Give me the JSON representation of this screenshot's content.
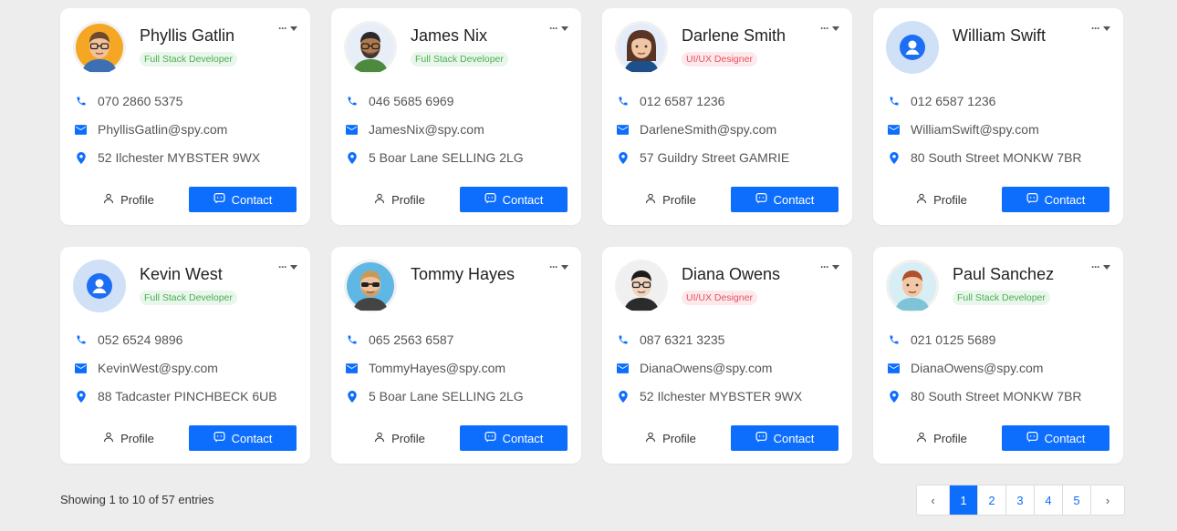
{
  "cards": [
    {
      "name": "Phyllis Gatlin",
      "role": "Full Stack Developer",
      "role_type": "fs",
      "phone": "070 2860 5375",
      "email": "PhyllisGatlin@spy.com",
      "address": "52 Ilchester MYBSTER 9WX",
      "avatar": "avatar-man-glasses",
      "profile_label": "Profile",
      "contact_label": "Contact"
    },
    {
      "name": "James Nix",
      "role": "Full Stack Developer",
      "role_type": "fs",
      "phone": "046 5685 6969",
      "email": "JamesNix@spy.com",
      "address": "5 Boar Lane SELLING 2LG",
      "avatar": "avatar-man-beard",
      "profile_label": "Profile",
      "contact_label": "Contact"
    },
    {
      "name": "Darlene Smith",
      "role": "UI/UX Designer",
      "role_type": "ux",
      "phone": "012 6587 1236",
      "email": "DarleneSmith@spy.com",
      "address": "57 Guildry Street GAMRIE",
      "avatar": "avatar-woman",
      "profile_label": "Profile",
      "contact_label": "Contact"
    },
    {
      "name": "William Swift",
      "role": "",
      "role_type": "none",
      "phone": "012 6587 1236",
      "email": "WilliamSwift@spy.com",
      "address": "80 South Street MONKW 7BR",
      "avatar": "avatar-placeholder",
      "profile_label": "Profile",
      "contact_label": "Contact"
    },
    {
      "name": "Kevin West",
      "role": "Full Stack Developer",
      "role_type": "fs",
      "phone": "052 6524 9896",
      "email": "KevinWest@spy.com",
      "address": "88 Tadcaster PINCHBECK 6UB",
      "avatar": "avatar-placeholder",
      "profile_label": "Profile",
      "contact_label": "Contact"
    },
    {
      "name": "Tommy Hayes",
      "role": "",
      "role_type": "none",
      "phone": "065 2563 6587",
      "email": "TommyHayes@spy.com",
      "address": "5 Boar Lane SELLING 2LG",
      "avatar": "avatar-man-sunglasses",
      "profile_label": "Profile",
      "contact_label": "Contact"
    },
    {
      "name": "Diana Owens",
      "role": "UI/UX Designer",
      "role_type": "ux",
      "phone": "087 6321 3235",
      "email": "DianaOwens@spy.com",
      "address": "52 Ilchester MYBSTER 9WX",
      "avatar": "avatar-man-dark-hair",
      "profile_label": "Profile",
      "contact_label": "Contact"
    },
    {
      "name": "Paul Sanchez",
      "role": "Full Stack Developer",
      "role_type": "fs",
      "phone": "021 0125 5689",
      "email": "DianaOwens@spy.com",
      "address": "80 South Street MONKW 7BR",
      "avatar": "avatar-man-redhead",
      "profile_label": "Profile",
      "contact_label": "Contact"
    }
  ],
  "footer": {
    "showing": "Showing 1 to 10 of 57 entries"
  },
  "pagination": {
    "prev": "‹",
    "next": "›",
    "pages": [
      "1",
      "2",
      "3",
      "4",
      "5"
    ],
    "active": "1"
  },
  "colors": {
    "primary": "#0d6efd",
    "fs_badge_text": "#4caf50",
    "ux_badge_text": "#e5535f"
  }
}
